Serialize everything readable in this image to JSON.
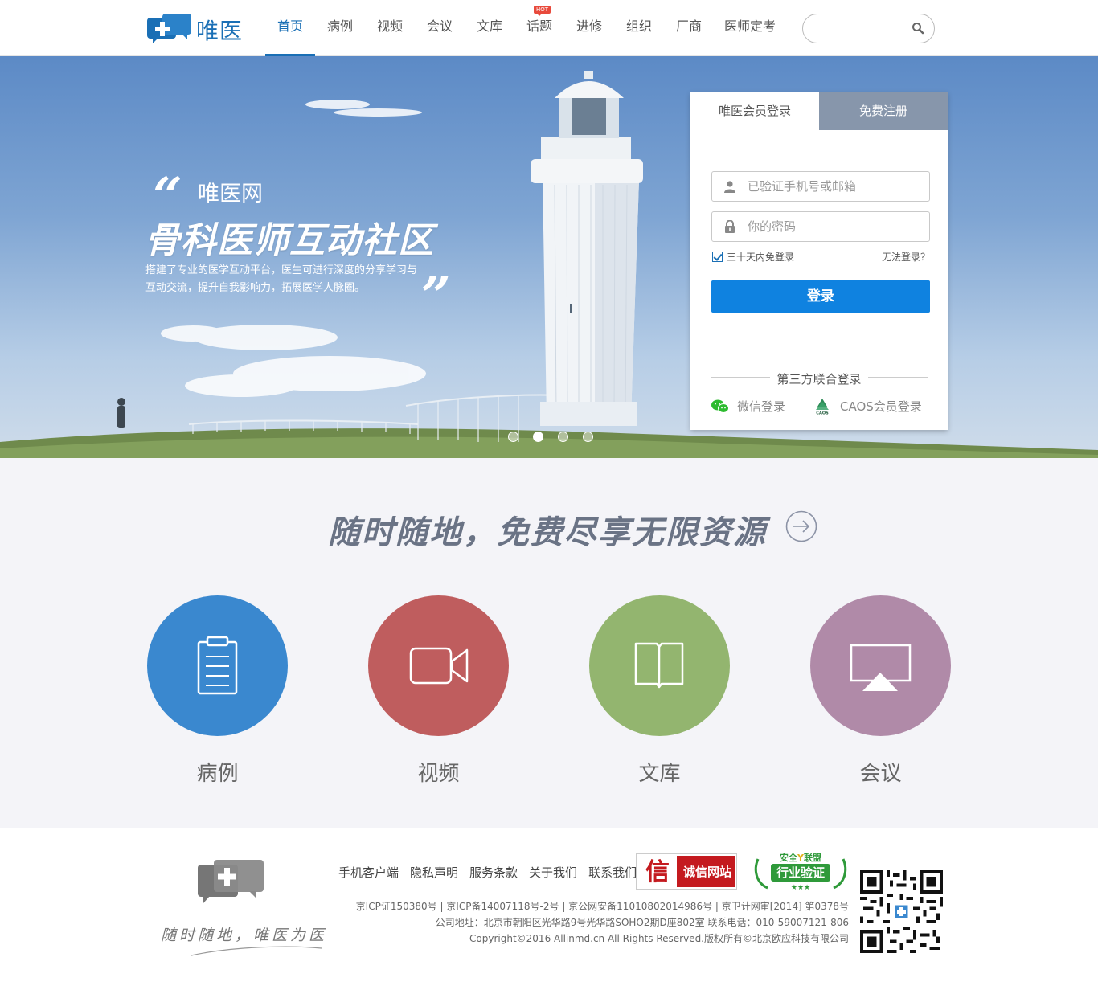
{
  "header": {
    "logo_text": "唯医",
    "nav": [
      {
        "label": "首页",
        "active": true
      },
      {
        "label": "病例"
      },
      {
        "label": "视频"
      },
      {
        "label": "会议"
      },
      {
        "label": "文库"
      },
      {
        "label": "话题",
        "badge": "HOT"
      },
      {
        "label": "进修"
      },
      {
        "label": "组织"
      },
      {
        "label": "厂商"
      },
      {
        "label": "医师定考"
      }
    ],
    "search_placeholder": ""
  },
  "banner": {
    "site_name": "唯医网",
    "main_slogan": "骨科医师互动社区",
    "description": "搭建了专业的医学互动平台，医生可进行深度的分享学习与互动交流，提升自我影响力，拓展医学人脉圈。",
    "slides": 4,
    "active_slide": 2
  },
  "login": {
    "tab_login": "唯医会员登录",
    "tab_register": "免费注册",
    "account_placeholder": "已验证手机号或邮箱",
    "password_placeholder": "你的密码",
    "remember_label": "三十天内免登录",
    "forgot_label": "无法登录？",
    "submit_label": "登录",
    "third_party_title": "第三方联合登录",
    "wechat_label": "微信登录",
    "caos_label": "CAOS会员登录"
  },
  "middle": {
    "headline": "随时随地，免费尽享无限资源",
    "features": [
      {
        "label": "病例",
        "color": "#3a88cf",
        "icon": "clipboard-icon"
      },
      {
        "label": "视频",
        "color": "#bf5d5e",
        "icon": "video-camera-icon"
      },
      {
        "label": "文库",
        "color": "#93b56f",
        "icon": "book-icon"
      },
      {
        "label": "会议",
        "color": "#b08aa8",
        "icon": "presentation-icon"
      }
    ]
  },
  "footer": {
    "slogan": "随时随地，唯医为医",
    "links": [
      "手机客户端",
      "隐私声明",
      "服务条款",
      "关于我们",
      "联系我们"
    ],
    "badge_honest": "诚信网站",
    "badge_honest_char": "信",
    "badge_industry_top": "安全",
    "badge_industry_mid": "联盟",
    "badge_industry_main": "行业验证",
    "info_line1": "京ICP证150380号 | 京ICP备14007118号-2号 | 京公网安备11010802014986号 | 京卫计网审[2014] 第0378号",
    "info_line2": "公司地址：北京市朝阳区光华路9号光华路SOHO2期D座802室 联系电话：010-59007121-806",
    "info_line3": "Copyright©2016 Allinmd.cn All Rights Reserved.版权所有©北京欧应科技有限公司"
  },
  "colors": {
    "brand": "#1a6fb5",
    "login_button": "#0f82e0",
    "register_tab": "#8796ab"
  }
}
